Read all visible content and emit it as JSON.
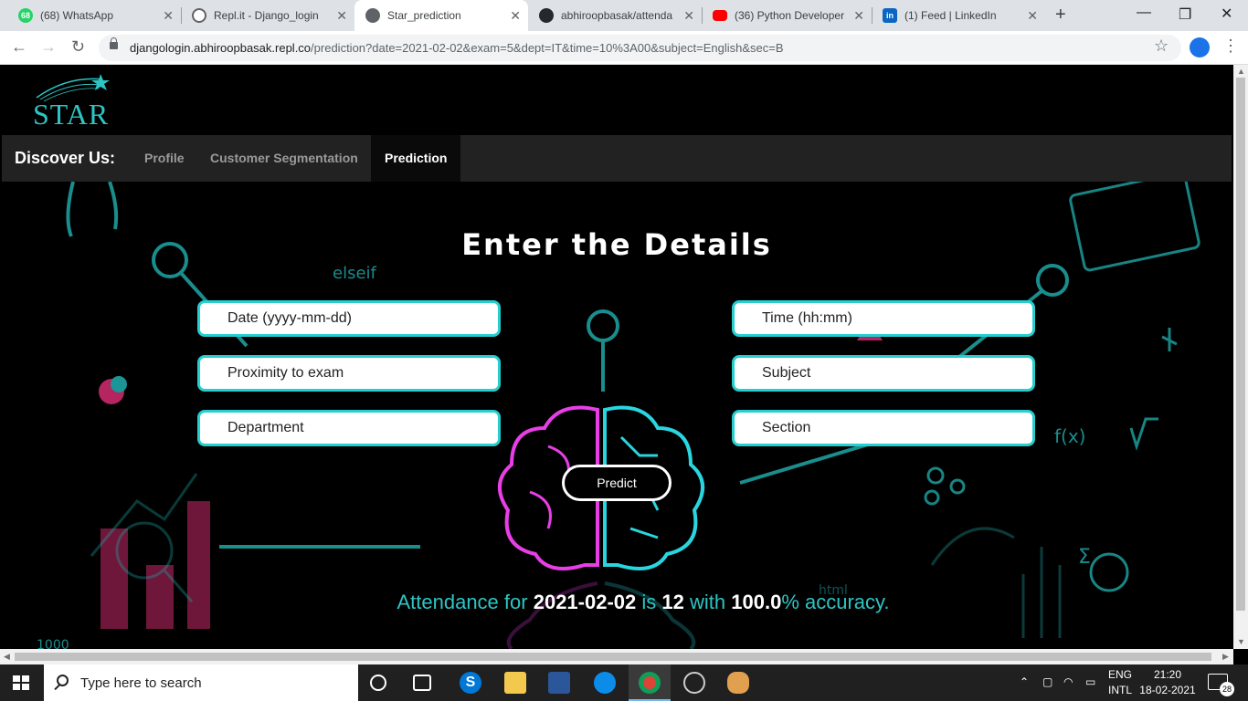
{
  "browser": {
    "tabs": [
      {
        "title": "(68) WhatsApp",
        "badge": "68",
        "color": "#25d366",
        "active": false
      },
      {
        "title": "Repl.it - Django_login",
        "badge": "",
        "color": "#5f6368",
        "active": false
      },
      {
        "title": "Star_prediction",
        "badge": "",
        "color": "#5f6368",
        "active": true
      },
      {
        "title": "abhiroopbasak/attenda",
        "badge": "",
        "color": "#24292e",
        "active": false
      },
      {
        "title": "(36) Python Developer",
        "badge": "",
        "color": "#ff0000",
        "active": false
      },
      {
        "title": "(1) Feed | LinkedIn",
        "badge": "in",
        "color": "#0a66c2",
        "active": false
      }
    ],
    "url_host": "djangologin.abhiroopbasak.repl.co",
    "url_path": "/prediction?date=2021-02-02&exam=5&dept=IT&time=10%3A00&subject=English&sec=B"
  },
  "site": {
    "logo_text": "STAR",
    "brand": "Discover Us:",
    "nav": [
      "Profile",
      "Customer Segmentation",
      "Prediction"
    ],
    "active_nav": "Prediction",
    "accent_color": "#25cfcf"
  },
  "form": {
    "heading": "Enter the Details",
    "fields": {
      "date": "Date (yyyy-mm-dd)",
      "time": "Time (hh:mm)",
      "exam": "Proximity to exam",
      "subject": "Subject",
      "dept": "Department",
      "section": "Section"
    },
    "submit_label": "Predict"
  },
  "result": {
    "prefix": "Attendance for",
    "date": "2021-02-02",
    "is": "is",
    "count": "12",
    "with": "with",
    "accuracy": "100.0",
    "suffix": "% accuracy."
  },
  "taskbar": {
    "search_placeholder": "Type here to search",
    "lang_line1": "ENG",
    "lang_line2": "INTL",
    "time": "21:20",
    "date": "18-02-2021",
    "notifications": "28"
  }
}
